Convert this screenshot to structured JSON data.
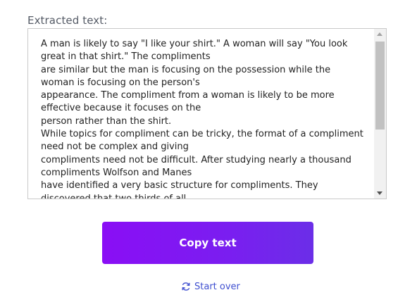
{
  "extracted_label": "Extracted text:",
  "extracted_text": "A man is likely to say \"I like your shirt.\" A woman will say \"You look great in that shirt.\" The compliments\nare similar but the man is focusing on the possession while the woman is focusing on the person's\nappearance. The compliment from a woman is likely to be more effective because it focuses on the\nperson rather than the shirt.\nWhile topics for compliment can be tricky, the format of a compliment need not be complex and giving\ncompliments need not be difficult. After studying nearly a thousand compliments Wolfson and Manes\nhave identified a very basic structure for compliments. They discovered that two thirds of all",
  "buttons": {
    "copy_label": "Copy text",
    "start_over_label": "Start over"
  },
  "icons": {
    "start_over_icon": "refresh-icon"
  },
  "colors": {
    "accent": "#7a1ef0",
    "link": "#3f4fd0"
  }
}
